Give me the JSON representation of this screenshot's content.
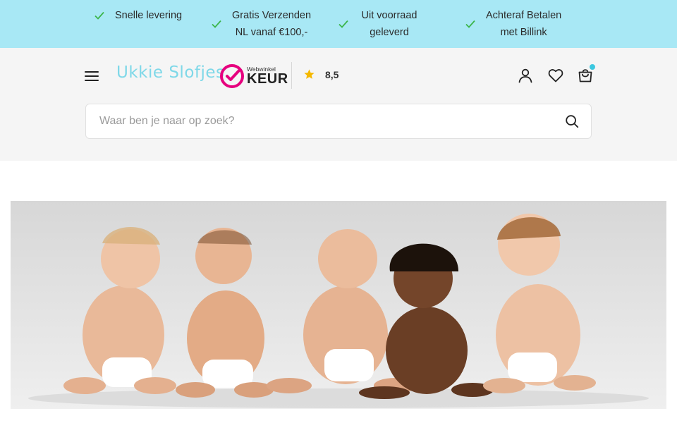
{
  "usp_bar": {
    "items": [
      {
        "label": "Snelle levering"
      },
      {
        "label": "Gratis Verzenden\nNL vanaf €100,-"
      },
      {
        "label": "Uit voorraad\ngeleverd"
      },
      {
        "label": "Achteraf Betalen\nmet Billink"
      }
    ],
    "check_color": "#3bb54a",
    "background": "#a8e8f5"
  },
  "header": {
    "logo_text": "Ukkie Slofjes",
    "keur": {
      "small": "Webwinkel",
      "big": "KEUR",
      "brand_color": "#e6007e"
    },
    "rating": {
      "value": "8,5",
      "star_color": "#f5b800"
    },
    "icons": {
      "menu": "hamburger-menu-icon",
      "account": "user-icon",
      "wishlist": "heart-icon",
      "cart": "shopping-bag-icon"
    },
    "cart_dot_color": "#3cc8e0"
  },
  "search": {
    "placeholder": "Waar ben je naar op zoek?",
    "value": ""
  },
  "hero": {
    "alt": "Vijf baby's in luiers zittend op een rij"
  }
}
